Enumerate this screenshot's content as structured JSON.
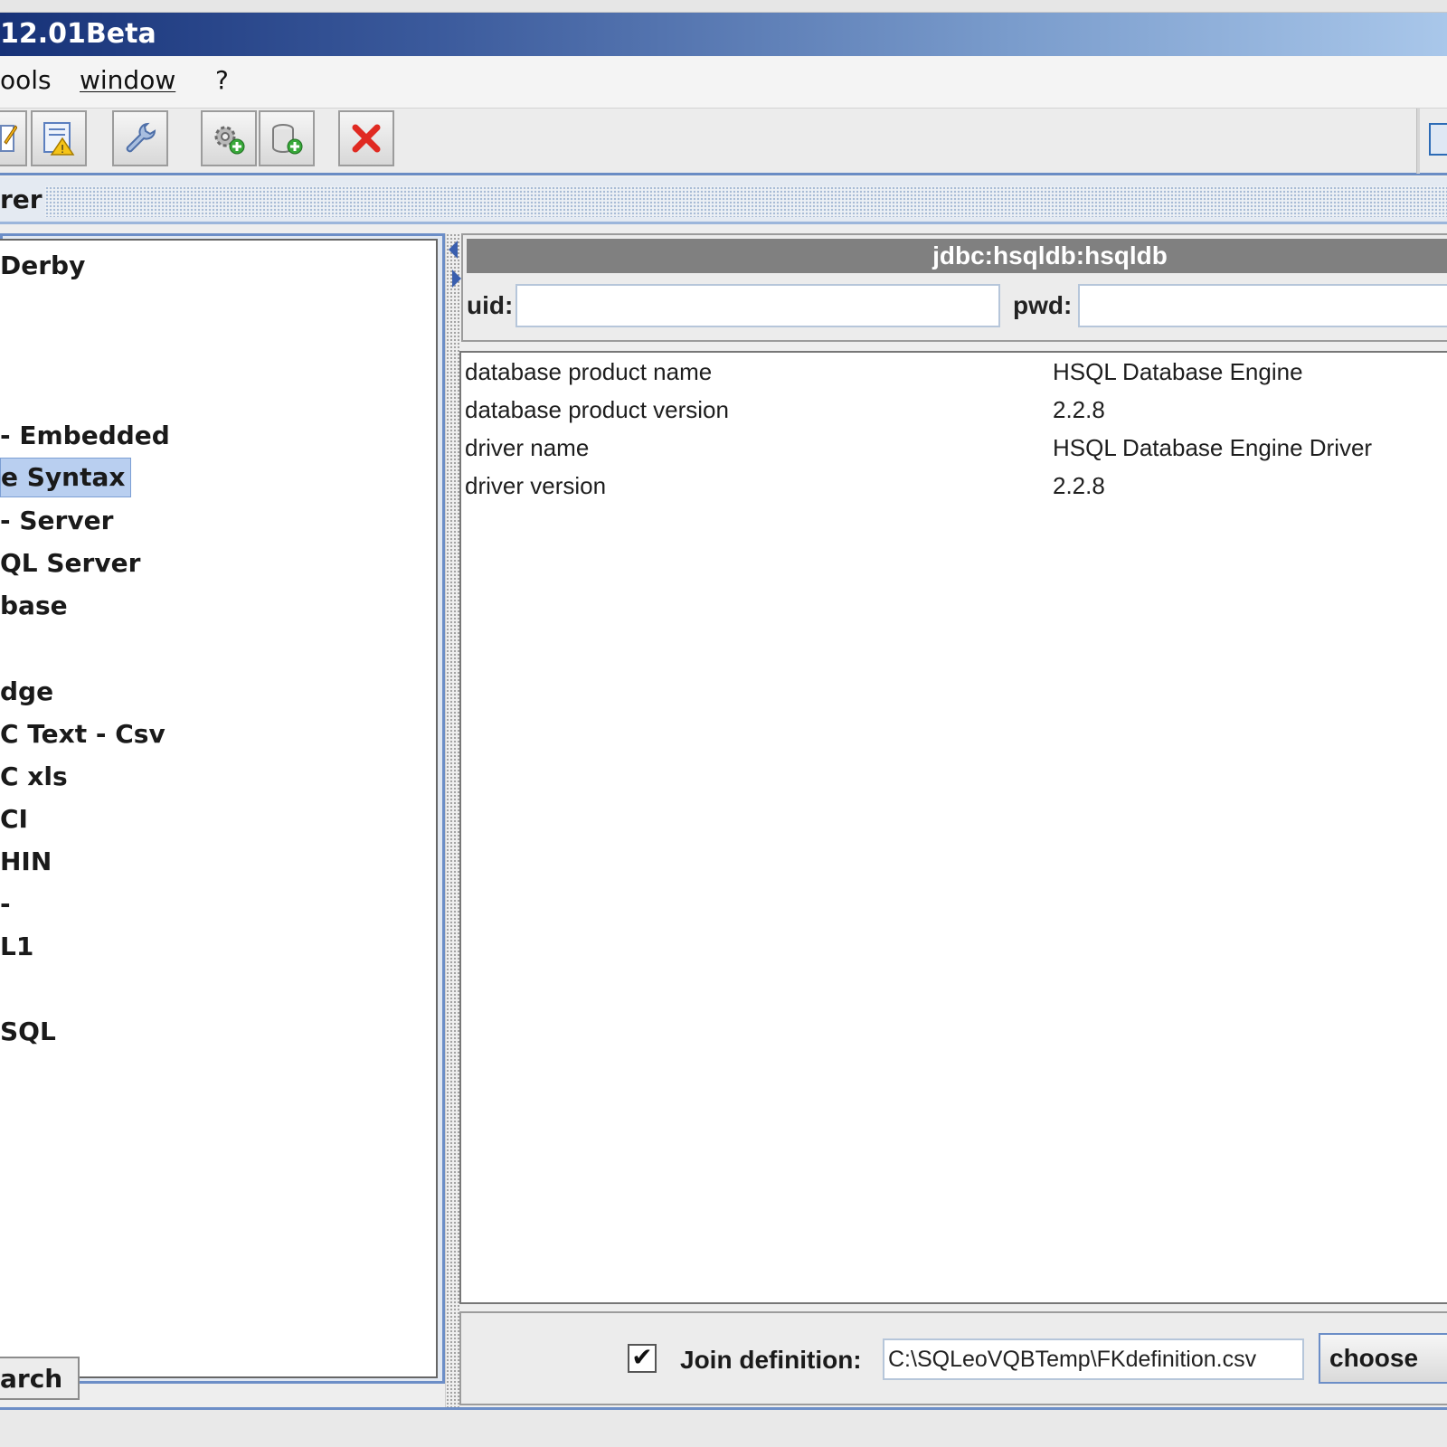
{
  "window": {
    "title": "12.01Beta"
  },
  "menu": {
    "items": [
      "ools",
      "window",
      "?"
    ]
  },
  "toolbar": {
    "buttons": [
      "edit-icon",
      "warning-report-icon",
      "wrench-icon",
      "settings-add-icon",
      "database-add-icon",
      "close-x-icon"
    ]
  },
  "panel": {
    "title": "rer"
  },
  "tree": {
    "items": [
      {
        "label": "Derby",
        "selected": false
      },
      {
        "label": "- Embedded",
        "selected": false
      },
      {
        "label": "e Syntax",
        "selected": true
      },
      {
        "label": "- Server",
        "selected": false
      },
      {
        "label": "QL Server",
        "selected": false
      },
      {
        "label": "base",
        "selected": false
      },
      {
        "label": "dge",
        "selected": false
      },
      {
        "label": "C Text - Csv",
        "selected": false
      },
      {
        "label": "C xls",
        "selected": false
      },
      {
        "label": "CI",
        "selected": false
      },
      {
        "label": "HIN",
        "selected": false
      },
      {
        "label": "-",
        "selected": false
      },
      {
        "label": "L1",
        "selected": false
      },
      {
        "label": "SQL",
        "selected": false
      }
    ]
  },
  "search_tab": {
    "label": "arch"
  },
  "connection": {
    "url": "jdbc:hsqldb:hsqldb",
    "uid_label": "uid:",
    "uid_value": "",
    "pwd_label": "pwd:",
    "pwd_value": ""
  },
  "info": {
    "rows": [
      {
        "name": "database product name",
        "value": "HSQL Database Engine"
      },
      {
        "name": "database product version",
        "value": "2.2.8"
      },
      {
        "name": "driver name",
        "value": "HSQL Database Engine Driver"
      },
      {
        "name": "driver version",
        "value": "2.2.8"
      }
    ]
  },
  "join": {
    "checked": true,
    "check_mark": "✔",
    "label": "Join definition:",
    "path": "C:\\SQLeoVQBTemp\\FKdefinition.csv",
    "choose_label": "choose"
  },
  "colors": {
    "title_gradient_start": "#173278",
    "title_gradient_end": "#a9c7ea",
    "accent_border": "#6c8ec7",
    "selection": "#b9cff0",
    "url_bar": "#808080"
  }
}
